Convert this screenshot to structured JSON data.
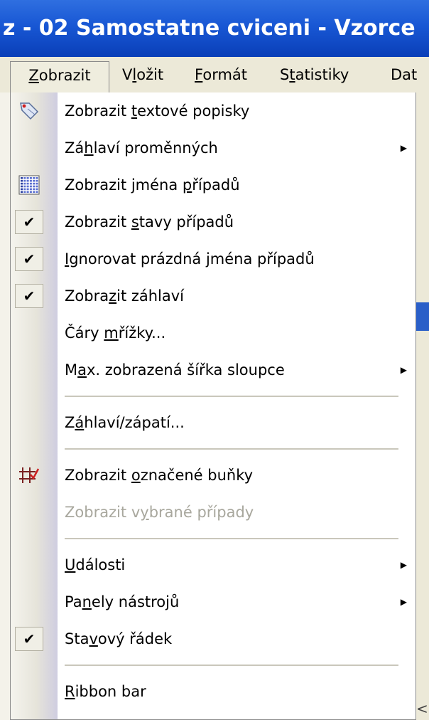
{
  "title": "z - 02 Samostatne cviceni - Vzorce",
  "menubar": [
    {
      "pre": "",
      "u": "Z",
      "post": "obrazit",
      "active": true
    },
    {
      "pre": "V",
      "u": "l",
      "post": "ožit"
    },
    {
      "pre": "",
      "u": "F",
      "post": "ormát"
    },
    {
      "pre": "S",
      "u": "t",
      "post": "atistiky"
    },
    {
      "pre": "Dat",
      "u": "",
      "post": ""
    }
  ],
  "menu": {
    "items": [
      {
        "pre": "Zobrazit ",
        "u": "t",
        "post": "extové popisky",
        "icon": "tag-icon"
      },
      {
        "pre": "Zá",
        "u": "h",
        "post": "laví proměnných",
        "submenu": true
      },
      {
        "pre": "Zobrazit jména ",
        "u": "p",
        "post": "řípadů",
        "icon": "grid-icon"
      },
      {
        "pre": "Zobrazit ",
        "u": "s",
        "post": "tavy případů",
        "checked": true
      },
      {
        "pre": "",
        "u": "I",
        "post": "gnorovat prázdná jména případů",
        "checked": true
      },
      {
        "pre": "Zobra",
        "u": "z",
        "post": "it záhlaví",
        "checked": true
      },
      {
        "pre": "Čáry ",
        "u": "m",
        "post": "řížky..."
      },
      {
        "pre": "M",
        "u": "a",
        "post": "x. zobrazená šířka sloupce",
        "submenu": true
      },
      {
        "sep": true
      },
      {
        "pre": "Z",
        "u": "á",
        "post": "hlaví/zápatí..."
      },
      {
        "sep": true
      },
      {
        "pre": "Zobrazit ",
        "u": "o",
        "post": "značené buňky",
        "icon": "marked-cells-icon"
      },
      {
        "pre": "Zobrazit v",
        "u": "y",
        "post": "brané případy",
        "disabled": true
      },
      {
        "sep": true
      },
      {
        "pre": "",
        "u": "U",
        "post": "dálosti",
        "submenu": true
      },
      {
        "pre": "Pa",
        "u": "n",
        "post": "ely nástrojů",
        "submenu": true
      },
      {
        "pre": "Sta",
        "u": "v",
        "post": "ový řádek",
        "checked": true
      },
      {
        "sep": true
      },
      {
        "pre": "",
        "u": "R",
        "post": "ibbon bar"
      }
    ]
  },
  "glyphs": {
    "check": "✔",
    "submenu_arrow": "▶",
    "corner": "<"
  },
  "colors": {
    "title_bar": "#1857d4",
    "menubar_bg": "#ece9d8",
    "disabled_text": "#a8a79d"
  }
}
